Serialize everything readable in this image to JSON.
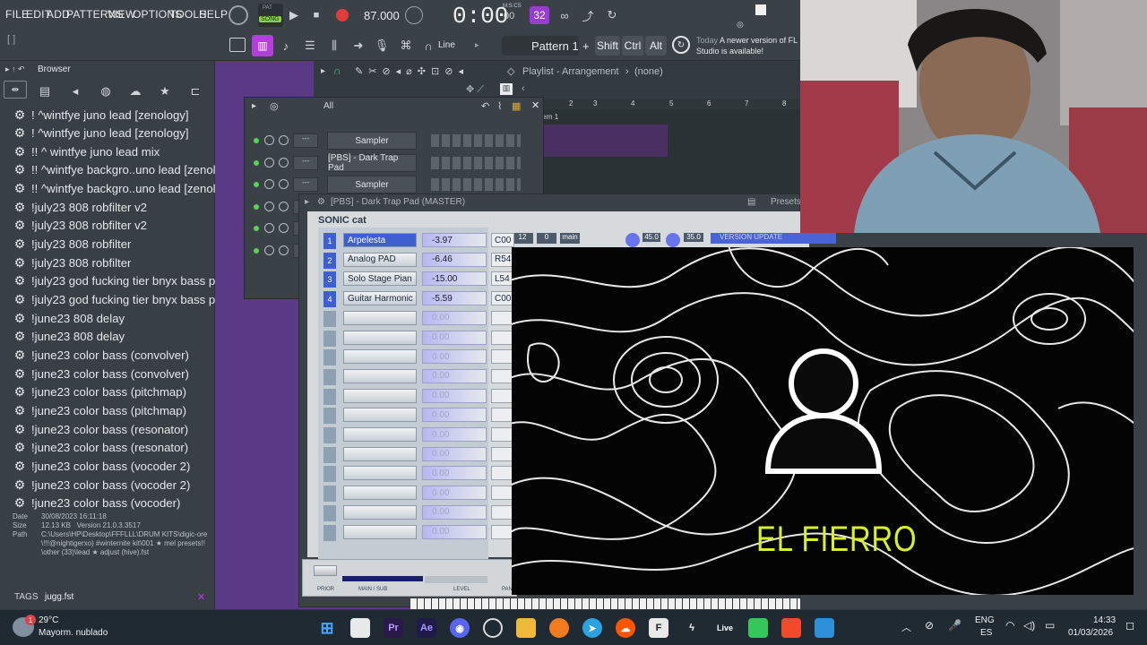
{
  "menu": {
    "items": [
      "FILE",
      "EDIT",
      "ADD",
      "PATTERNS",
      "VIEW",
      "OPTIONS",
      "TOOLS",
      "HELP"
    ],
    "pat_label": "PAT",
    "song_label": "SONG",
    "tempo": "87.000",
    "time": "0:00",
    "time_small": "00",
    "time_unit": "M:S:CS",
    "snap_value": "32",
    "line_label": "Line",
    "pattern_label": "Pattern 1",
    "shift_label": "Shift",
    "ctrl_label": "Ctrl",
    "alt_label": "Alt",
    "notice_date": "Today",
    "notice_text": "A newer version of FL Studio is available!",
    "hint_text": "[ ]"
  },
  "browser": {
    "title": "Browser",
    "items": [
      "! ^wintfye juno lead [zenology]",
      "! ^wintfye juno lead [zenology]",
      "!! ^ wintfye juno lead mix",
      "!! ^wintfye backgro..uno lead [zenology]",
      "!! ^wintfye backgro..uno lead [zenology]",
      "!july23 808 robfilter v2",
      "!july23 808 robfilter v2",
      "!july23 808 robfilter",
      "!july23 808 robfilter",
      "!july23 god fucking tier bnyx bass preset",
      "!july23 god fucking tier bnyx bass preset",
      "!june23 808 delay",
      "!june23 808 delay",
      "!june23 color bass (convolver)",
      "!june23 color bass (convolver)",
      "!june23 color bass (pitchmap)",
      "!june23 color bass (pitchmap)",
      "!june23 color bass (resonator)",
      "!june23 color bass (resonator)",
      "!june23 color bass (vocoder 2)",
      "!june23 color bass (vocoder 2)",
      "!june23 color bass (vocoder)"
    ],
    "info": {
      "date_label": "Date",
      "date_value": "30/08/2023 16:11:18",
      "size_label": "Size",
      "size_value": "12.13 KB",
      "version_label": "Version",
      "version_value": "21.0.3.3517",
      "path_label": "Path",
      "path_value": "C:\\Users\\HP\\Desktop\\FFFLLL\\DRUM KITS\\digic-ore\\!!!@nightigerxo) #winternite kit\\001 ★ mel presets!!\\other (33)\\lead ★ adjust (hive).fst"
    },
    "tags_label": "TAGS",
    "tags_value": "jugg.fst"
  },
  "playlist": {
    "title": "Playlist - Arrangement",
    "subtitle": "(none)",
    "track_label": "ern 1",
    "bars": [
      "2",
      "3",
      "4",
      "5",
      "6",
      "7",
      "8"
    ]
  },
  "rack": {
    "filter": "All",
    "channels": [
      "Sampler",
      "[PBS] - Dark Trap Pad",
      "Sampler"
    ]
  },
  "plugin": {
    "window_title": "[PBS] - Dark Trap Pad (MASTER)",
    "presets_label": "Presets",
    "brand": "SONIC cat",
    "update_label": "VERSION UPDATE",
    "voices_value": "12",
    "transp_value": "0",
    "out_value": "main",
    "chorus_value": "45.0",
    "reverb_value": "35.0",
    "header_labels": [
      "PAN",
      "VOICES",
      "TRANSP",
      "OUT",
      "CHORUS",
      "REVERB"
    ],
    "level_label": "LEVEL",
    "layers": [
      {
        "n": "1",
        "name": "Arpelesta",
        "level": "-3.97",
        "pan": "C00"
      },
      {
        "n": "2",
        "name": "Analog PAD",
        "level": "-6.46",
        "pan": "R54"
      },
      {
        "n": "3",
        "name": "Solo Stage Pian",
        "level": "-15.00",
        "pan": "L54"
      },
      {
        "n": "4",
        "name": "Guitar Harmonic",
        "level": "-5.59",
        "pan": "C00"
      }
    ],
    "empty_level": "0.00",
    "footer": [
      "PRIOR",
      "MAIN / SUB",
      "LEVEL",
      "PAN"
    ]
  },
  "video": {
    "caption": "EL FIERRO"
  },
  "taskbar": {
    "weather_temp": "29°C",
    "weather_desc": "Mayorm. nublado",
    "badge_count": "1",
    "lang_top": "ENG",
    "lang_bottom": "ES",
    "clock_time": "14:33",
    "clock_date": "01/03/2026",
    "apps": [
      "windows-start",
      "file-explorer",
      "premiere",
      "after-effects",
      "discord",
      "chrome",
      "folder",
      "fl-studio",
      "telegram",
      "soundcloud",
      "capcut",
      "f-app",
      "music-app",
      "live-app",
      "android-app",
      "mail-app",
      "brave",
      "photos"
    ]
  },
  "colors": {
    "accent_purple": "#5a3a87",
    "panel": "#3b4247",
    "caption_yellow": "#d9f028",
    "plugin_blue": "#3d5fd0"
  }
}
